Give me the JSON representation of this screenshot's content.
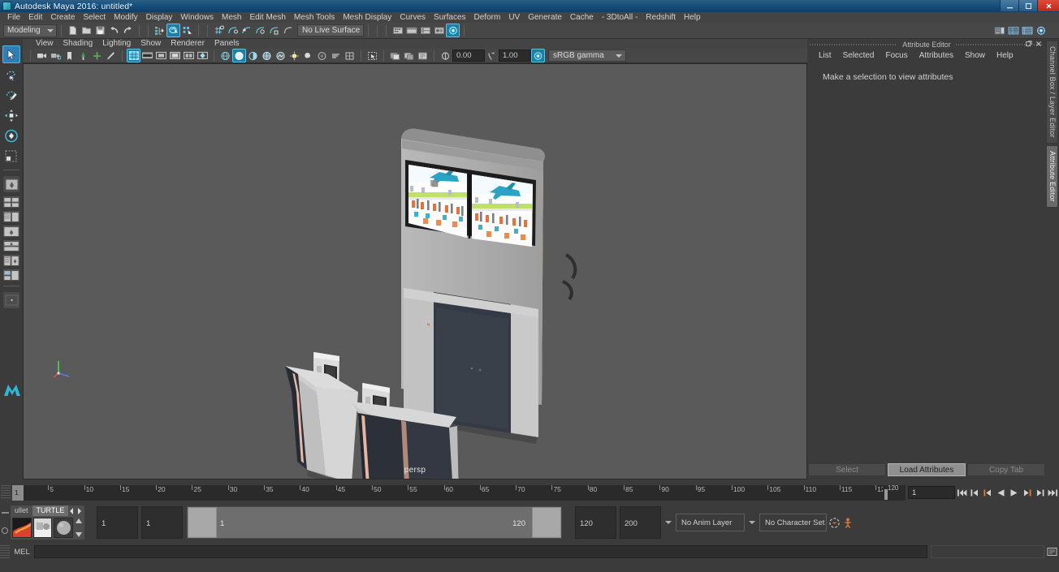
{
  "window": {
    "title": "Autodesk Maya 2016: untitled*",
    "app_icon": "maya-icon",
    "controls": [
      {
        "name": "minimize-button",
        "glyph": "—"
      },
      {
        "name": "maximize-button",
        "glyph": "❐"
      },
      {
        "name": "close-button",
        "glyph": "✕"
      }
    ]
  },
  "menu_bar": [
    "File",
    "Edit",
    "Create",
    "Select",
    "Modify",
    "Display",
    "Windows",
    "Mesh",
    "Edit Mesh",
    "Mesh Tools",
    "Mesh Display",
    "Curves",
    "Surfaces",
    "Deform",
    "UV",
    "Generate",
    "Cache",
    "- 3DtoAll -",
    "Redshift",
    "Help"
  ],
  "toolbar": {
    "menu_set": "Modeling",
    "live_surface": "No Live Surface",
    "file_icons": [
      "new-scene-icon",
      "open-scene-icon",
      "save-scene-icon",
      "undo-icon",
      "redo-icon"
    ],
    "select_mode_icons": [
      "select-by-hierarchy-icon",
      "select-by-object-type-icon",
      "select-by-component-type-icon"
    ],
    "snap_icons": [
      "snap-to-grid-icon",
      "snap-to-curve-icon",
      "snap-to-point-icon",
      "snap-to-projected-center-icon",
      "snap-to-view-plane-icon",
      "make-live-icon"
    ],
    "editor_icons": [
      "render-view-icon",
      "render-sequence-icon",
      "render-settings-icon",
      "hypershade-icon",
      "ipr-render-icon"
    ],
    "right_icons": [
      "show-hide-icon",
      "channel-box-toggle-icon",
      "attribute-editor-toggle-icon",
      "tool-settings-toggle-icon"
    ]
  },
  "toolbox": {
    "tools": [
      {
        "name": "select-tool",
        "icon": "arrow-cursor-icon",
        "selected": true
      },
      {
        "name": "lasso-select-tool",
        "icon": "lasso-icon",
        "selected": false
      },
      {
        "name": "paint-select-tool",
        "icon": "paint-brush-icon",
        "selected": false
      },
      {
        "name": "move-tool",
        "icon": "move-arrows-icon",
        "selected": false
      },
      {
        "name": "rotate-tool",
        "icon": "rotate-ring-icon",
        "selected": false
      },
      {
        "name": "scale-tool",
        "icon": "scale-box-icon",
        "selected": false
      }
    ],
    "layouts": [
      {
        "name": "single-perspective-layout",
        "icon": "single-pane-icon"
      },
      {
        "name": "four-view-layout",
        "icon": "four-pane-icon"
      },
      {
        "name": "two-pane-stacked-layout",
        "icon": "two-pane-stacked-icon"
      },
      {
        "name": "persp-outliner-layout",
        "icon": "persp-outliner-icon"
      },
      {
        "name": "persp-graph-layout",
        "icon": "persp-graph-icon"
      },
      {
        "name": "hypershade-layout",
        "icon": "hypershade-layout-icon"
      },
      {
        "name": "persp-uv-layout",
        "icon": "persp-uv-icon"
      },
      {
        "name": "extra-layout",
        "icon": "blank-layout-icon"
      }
    ]
  },
  "viewport": {
    "menus": [
      "View",
      "Shading",
      "Lighting",
      "Show",
      "Renderer",
      "Panels"
    ],
    "camera_label": "persp",
    "exposure_value": "0.00",
    "gamma_value": "1.00",
    "color_space": "sRGB gamma",
    "background_color": "#5a5a5a",
    "toolbar_icons": [
      "select-camera-icon",
      "camera-attributes-icon",
      "bookmark-icon",
      "image-plane-icon",
      "two-d-pan-zoom-icon",
      "grease-pencil-icon",
      "grid-toggle-icon",
      "film-gate-icon",
      "resolution-gate-icon",
      "gate-mask-icon",
      "exposure-icon",
      "xray-icon",
      "xray-joints-icon",
      "wireframe-icon",
      "smooth-shade-icon",
      "smooth-shade-all-icon",
      "wireframe-on-shaded-icon",
      "texture-toggle-icon",
      "lights-toggle-icon",
      "shadows-icon",
      "screen-space-ao-icon",
      "motion-blur-icon",
      "multisample-icon",
      "depth-peel-icon",
      "isolate-select-icon",
      "snapshot-icon",
      "snapshot-compare-icon",
      "viewport-settings-icon",
      "exposure-field-icon",
      "gamma-field-icon",
      "color-management-icon"
    ],
    "scene_objects": [
      "airport-information-kiosk-display-wall",
      "self-service-check-in-kiosk-left",
      "self-service-check-in-kiosk-right"
    ]
  },
  "attribute_editor": {
    "panel_title": "Attribute Editor",
    "window_buttons": [
      "undock-icon",
      "close-icon"
    ],
    "menus": [
      "List",
      "Selected",
      "Focus",
      "Attributes",
      "Show",
      "Help"
    ],
    "empty_message": "Make a selection to view attributes",
    "footer_buttons": [
      {
        "label": "Select",
        "active": false
      },
      {
        "label": "Load Attributes",
        "active": true
      },
      {
        "label": "Copy Tab",
        "active": false
      }
    ]
  },
  "side_tabs": [
    {
      "label": "Channel Box / Layer Editor",
      "active": false
    },
    {
      "label": "Attribute Editor",
      "active": true
    }
  ],
  "time_slider": {
    "current_frame": "1",
    "ticks": [
      {
        "label": "5",
        "frame": 5
      },
      {
        "label": "10",
        "frame": 10
      },
      {
        "label": "15",
        "frame": 15
      },
      {
        "label": "20",
        "frame": 20
      },
      {
        "label": "25",
        "frame": 25
      },
      {
        "label": "30",
        "frame": 30
      },
      {
        "label": "35",
        "frame": 35
      },
      {
        "label": "40",
        "frame": 40
      },
      {
        "label": "45",
        "frame": 45
      },
      {
        "label": "50",
        "frame": 50
      },
      {
        "label": "55",
        "frame": 55
      },
      {
        "label": "60",
        "frame": 60
      },
      {
        "label": "65",
        "frame": 65
      },
      {
        "label": "70",
        "frame": 70
      },
      {
        "label": "75",
        "frame": 75
      },
      {
        "label": "80",
        "frame": 80
      },
      {
        "label": "85",
        "frame": 85
      },
      {
        "label": "90",
        "frame": 90
      },
      {
        "label": "95",
        "frame": 95
      },
      {
        "label": "100",
        "frame": 100
      },
      {
        "label": "105",
        "frame": 105
      },
      {
        "label": "110",
        "frame": 110
      },
      {
        "label": "115",
        "frame": 115
      },
      {
        "label": "120",
        "frame": 120
      }
    ],
    "range_end_label": "120",
    "frame_field": "1",
    "playback_buttons": [
      "go-to-start-icon",
      "step-back-keyframe-icon",
      "step-back-frame-icon",
      "play-backwards-icon",
      "play-forwards-icon",
      "step-forward-frame-icon",
      "step-forward-keyframe-icon",
      "go-to-end-icon"
    ]
  },
  "range_slider": {
    "tabs": [
      {
        "label": "ullet",
        "active": false
      },
      {
        "label": "TURTLE",
        "active": true
      }
    ],
    "swatches": [
      "bullet-dynamics-swatch",
      "turtle-scene-swatch",
      "turtle-sphere-swatch"
    ],
    "range_start": "1",
    "anim_start": "1",
    "range_bar_start": "1",
    "range_bar_end": "120",
    "anim_end": "120",
    "range_end": "200",
    "anim_layer": "No Anim Layer",
    "character_set": "No Character Set",
    "right_icons": [
      "auto-keyframe-icon",
      "animation-preferences-icon"
    ]
  },
  "command_line": {
    "language_label": "MEL",
    "input_value": "",
    "input_placeholder": "",
    "output_value": "",
    "script_editor_icon": "script-editor-icon"
  }
}
